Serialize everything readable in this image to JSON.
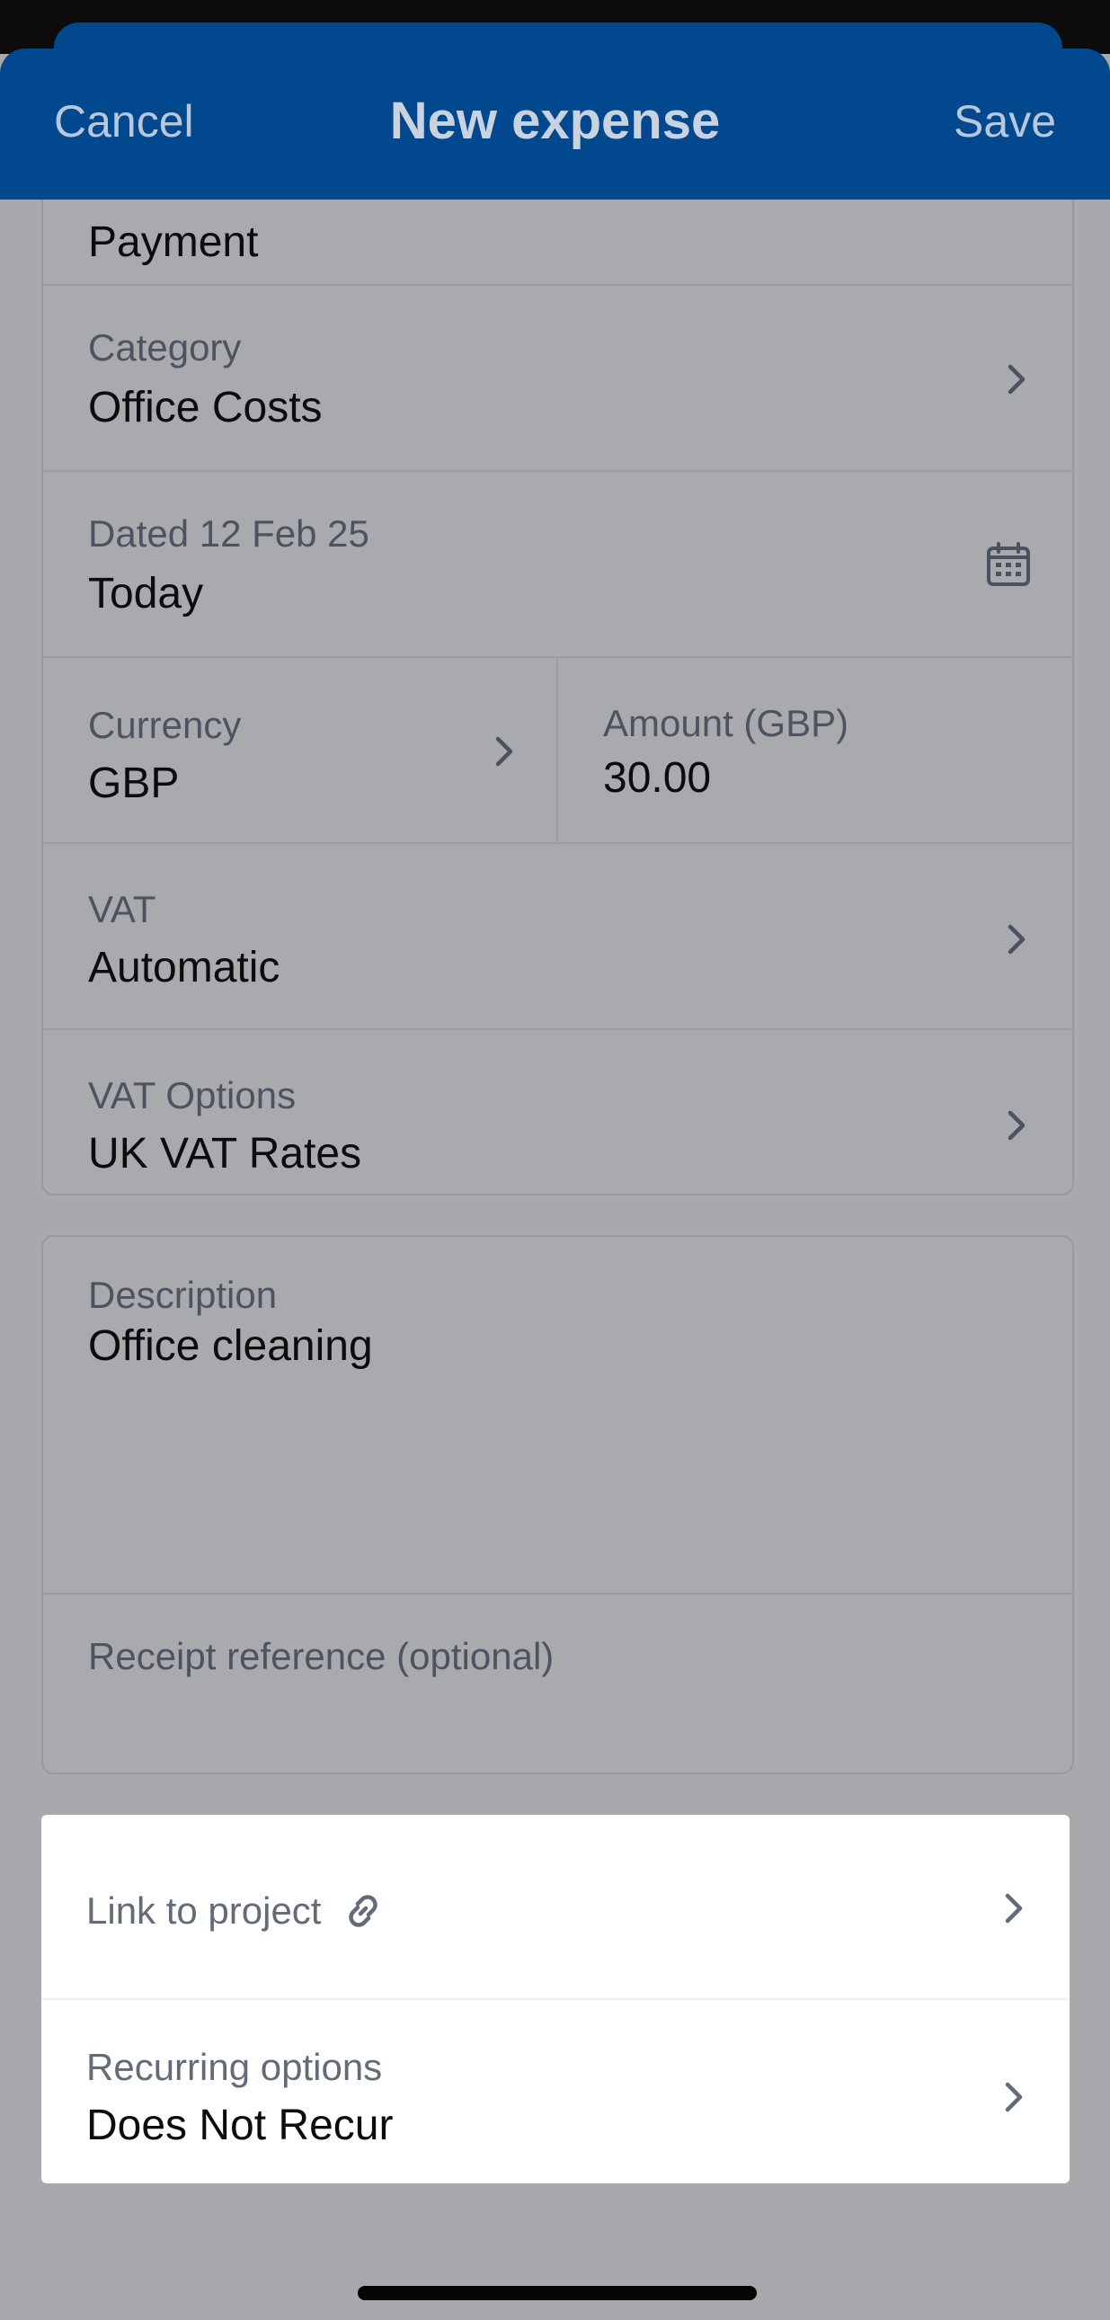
{
  "navbar": {
    "cancel_label": "Cancel",
    "title": "New expense",
    "save_label": "Save"
  },
  "form": {
    "payment_partial": "Payment",
    "category": {
      "label": "Category",
      "value": "Office Costs"
    },
    "date": {
      "label": "Dated 12 Feb 25",
      "value": "Today"
    },
    "currency": {
      "label": "Currency",
      "value": "GBP"
    },
    "amount": {
      "label": "Amount (GBP)",
      "value": "30.00"
    },
    "vat": {
      "label": "VAT",
      "value": "Automatic"
    },
    "vat_options": {
      "label": "VAT Options",
      "value": "UK VAT Rates"
    }
  },
  "description": {
    "label": "Description",
    "value": "Office cleaning",
    "receipt_placeholder": "Receipt reference (optional)"
  },
  "links": {
    "project_label": "Link to project",
    "recurring": {
      "label": "Recurring options",
      "value": "Does Not Recur"
    }
  },
  "icons": {
    "chevron": "chevron-right-icon",
    "calendar": "calendar-icon",
    "link": "link-icon"
  },
  "colors": {
    "navbar": "#02488f",
    "overlay_bg": "#a8a9ad",
    "white_card": "#ffffff"
  }
}
